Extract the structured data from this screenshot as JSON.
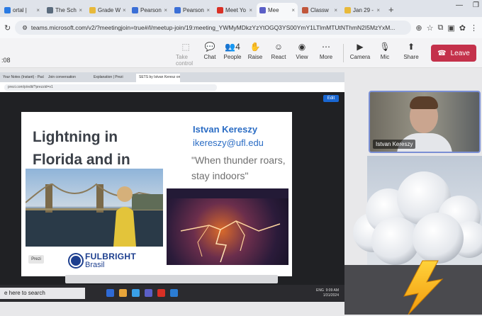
{
  "browser": {
    "tabs": [
      {
        "label": "ortal |",
        "color": "#2a7ae2",
        "active": false
      },
      {
        "label": "The Sch",
        "color": "#5a6b7d",
        "active": false
      },
      {
        "label": "Grade W",
        "color": "#e8b93a",
        "active": false
      },
      {
        "label": "Pearson",
        "color": "#3b6fd6",
        "active": false
      },
      {
        "label": "Pearson",
        "color": "#3b6fd6",
        "active": false
      },
      {
        "label": "Meet Yo",
        "color": "#d93025",
        "active": false
      },
      {
        "label": "Mee",
        "color": "#5b5fc7",
        "active": true
      },
      {
        "label": "Classw",
        "color": "#c1563b",
        "active": false
      },
      {
        "label": "Jan 29 -",
        "color": "#e8b93a",
        "active": false
      }
    ],
    "new_tab": "+",
    "url": "teams.microsoft.com/v2/?meetingjoin=true#/l/meetup-join/19:meeting_YWMyMDkzYzYtOGQ3YS00YmY1LTlmMTUtNThmN2I5MzYxM..."
  },
  "teams": {
    "time": ":08",
    "controls": [
      {
        "label": "Take control",
        "icon": "take-control-icon",
        "glyph": "⬚",
        "dim": true
      },
      {
        "label": "Chat",
        "icon": "chat-icon",
        "glyph": "💬",
        "dim": false
      },
      {
        "label": "People",
        "icon": "people-icon",
        "glyph": "👥4",
        "dim": false
      },
      {
        "label": "Raise",
        "icon": "raise-hand-icon",
        "glyph": "✋",
        "dim": false
      },
      {
        "label": "React",
        "icon": "react-icon",
        "glyph": "☺",
        "dim": false
      },
      {
        "label": "View",
        "icon": "view-icon",
        "glyph": "◉",
        "dim": false
      },
      {
        "label": "More",
        "icon": "more-icon",
        "glyph": "⋯",
        "dim": false
      },
      {
        "label": "Camera",
        "icon": "camera-icon",
        "glyph": "▶",
        "dim": false
      },
      {
        "label": "Mic",
        "icon": "mic-off-icon",
        "glyph": "🎙",
        "dim": false
      },
      {
        "label": "Share",
        "icon": "share-icon",
        "glyph": "⬆",
        "dim": false
      }
    ],
    "leave_label": "Leave",
    "leave_color": "#c4314b"
  },
  "shared_screen": {
    "tabs": [
      "Your Notes (Instant) - Pack Ro",
      "Join conversation",
      "Explanation | Prezi",
      "SETS by Istvan Keresz on Prez"
    ],
    "url": "prezi.com/p/edit/?prezzid=v1",
    "edit_label": "Edit",
    "slide": {
      "title": "Lightning in Florida and in Brazil",
      "speaker": "Istvan Kereszy",
      "email": "ikereszy@ufl.edu",
      "quote": "\"When thunder roars, stay indoors\"",
      "logo_main": "FULBRIGHT",
      "logo_sub": "Brasil",
      "badge": "Prezi"
    },
    "taskbar": {
      "search": "e here to search",
      "tray_time": "9:09 AM",
      "tray_date": "1/31/2024",
      "tray_lang": "ENG"
    }
  },
  "participant": {
    "name": "Istvan Kereszy"
  },
  "overlay": {
    "emoji": "thunder-cloud-icon"
  }
}
